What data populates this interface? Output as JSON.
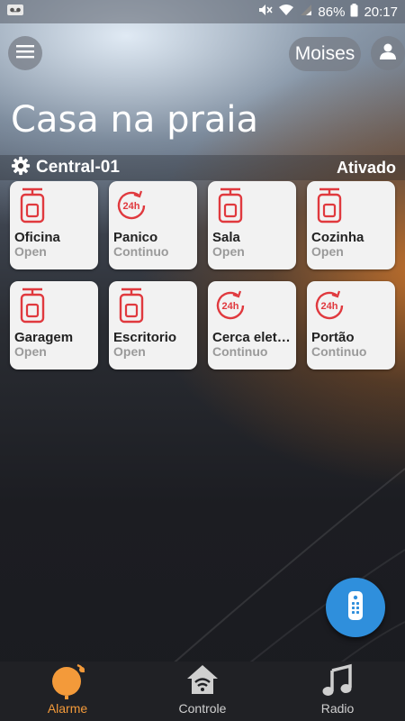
{
  "status_bar": {
    "battery_percent": "86%",
    "time": "20:17"
  },
  "header": {
    "user_name": "Moises",
    "page_title": "Casa na praia"
  },
  "central": {
    "name": "Central-01",
    "status": "Ativado"
  },
  "zones": [
    {
      "name": "Oficina",
      "state": "Open",
      "icon": "pir-sensor-icon"
    },
    {
      "name": "Panico",
      "state": "Continuo",
      "icon": "24h-icon"
    },
    {
      "name": "Sala",
      "state": "Open",
      "icon": "pir-sensor-icon"
    },
    {
      "name": "Cozinha",
      "state": "Open",
      "icon": "pir-sensor-icon"
    },
    {
      "name": "Garagem",
      "state": "Open",
      "icon": "pir-sensor-icon"
    },
    {
      "name": "Escritorio",
      "state": "Open",
      "icon": "pir-sensor-icon"
    },
    {
      "name": "Cerca eletrica",
      "state": "Continuo",
      "icon": "24h-icon"
    },
    {
      "name": "Portão",
      "state": "Continuo",
      "icon": "24h-icon"
    }
  ],
  "nav": {
    "alarm_label": "Alarme",
    "control_label": "Controle",
    "radio_label": "Radio"
  },
  "colors": {
    "accent_orange": "#f39a3a",
    "sensor_red": "#e0393e",
    "fab_blue": "#2f8fdc"
  }
}
